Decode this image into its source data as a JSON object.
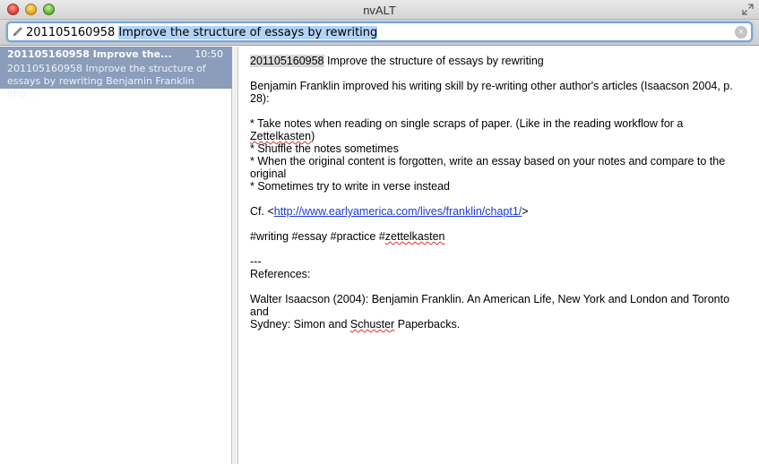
{
  "window": {
    "title": "nvALT"
  },
  "search": {
    "id_part": "201105160958",
    "selected_part": "Improve the structure of essays by rewriting"
  },
  "note_list": {
    "items": [
      {
        "title": "201105160958 Improve the...",
        "time": "10:50",
        "preview_line1": "201105160958 Improve the structure of",
        "preview_line2": "essays by rewriting  Benjamin Franklin imp..."
      }
    ]
  },
  "editor": {
    "title_id": "201105160958",
    "title_rest": " Improve the structure of essays by rewriting",
    "intro": "Benjamin Franklin improved his writing skill by re-writing other author's articles (Isaacson 2004, p. 28):",
    "bullet1_a": "* Take notes when reading on single scraps of paper. (Like in the reading workflow for a ",
    "bullet1_word": "Zettelkasten",
    "bullet1_b": ")",
    "bullet2": "* Shuffle the notes sometimes",
    "bullet3": "* When the original content is forgotten, write an essay based on your notes and compare to the original",
    "bullet4": "* Sometimes try to write in verse instead",
    "cf_prefix": "Cf. <",
    "cf_link": "http://www.earlyamerica.com/lives/franklin/chapt1/",
    "cf_suffix": ">",
    "tags_a": "#writing #essay #practice #",
    "tags_word": "zettelkasten",
    "separator": "---",
    "references_heading": "References:",
    "ref_line1": "Walter Isaacson (2004):  Benjamin Franklin. An American Life, New York and London and Toronto and",
    "ref_line2a": "Sydney: Simon and ",
    "ref_word": "Schuster",
    "ref_line2b": " Paperbacks."
  },
  "icons": {
    "pencil": "pencil-icon",
    "clear": "clear-icon",
    "fullscreen": "fullscreen-icon"
  },
  "colors": {
    "selection": "#b3d3f6",
    "note_row_selected": "#8a9dba",
    "link": "#1a37d6",
    "spell_underline": "#e0302a"
  }
}
